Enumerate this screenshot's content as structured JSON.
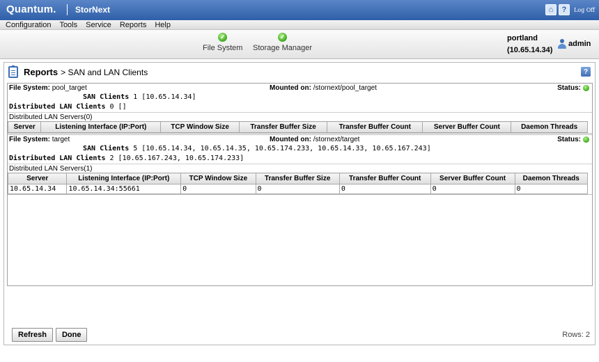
{
  "header": {
    "brand": "Quantum.",
    "product": "StorNext",
    "home_icon": "home-icon",
    "help_icon": "question-icon",
    "logoff_label": "Log Off"
  },
  "menu": {
    "items": [
      "Configuration",
      "Tools",
      "Service",
      "Reports",
      "Help"
    ]
  },
  "status": {
    "items": [
      {
        "label": "File System",
        "icon": "check-icon",
        "color": "#3caa1e"
      },
      {
        "label": "Storage Manager",
        "icon": "check-icon",
        "color": "#3caa1e"
      }
    ],
    "server_name": "portland",
    "server_ip": "(10.65.14.34)",
    "user": "admin"
  },
  "page": {
    "title_bold": "Reports",
    "title_rest": "> SAN and LAN Clients",
    "help": "?"
  },
  "filesystems": [
    {
      "fs_label": "File System:",
      "fs_name": "pool_target",
      "mount_label": "Mounted on:",
      "mount_path": "/stornext/pool_target",
      "status_label": "Status:",
      "san_label": "SAN Clients",
      "san_value": "1 [10.65.14.34]",
      "lan_label": "Distributed LAN Clients",
      "lan_value": "0 []",
      "servers_label": "Distributed LAN Servers",
      "servers_count": "(0)"
    },
    {
      "fs_label": "File System:",
      "fs_name": "target",
      "mount_label": "Mounted on:",
      "mount_path": "/stornext/target",
      "status_label": "Status:",
      "san_label": "SAN Clients",
      "san_value": "5 [10.65.14.34, 10.65.14.35, 10.65.174.233, 10.65.14.33, 10.65.167.243]",
      "lan_label": "Distributed LAN Clients",
      "lan_value": "2 [10.65.167.243, 10.65.174.233]",
      "servers_label": "Distributed LAN Servers",
      "servers_count": "(1)"
    }
  ],
  "table": {
    "columns": [
      "Server",
      "Listening Interface (IP:Port)",
      "TCP Window Size",
      "Transfer Buffer Size",
      "Transfer Buffer Count",
      "Server Buffer Count",
      "Daemon Threads"
    ],
    "rows": [
      [
        "10.65.14.34",
        "10.65.14.34:55661",
        "0",
        "0",
        "0",
        "0",
        "0"
      ]
    ]
  },
  "footer": {
    "refresh_label": "Refresh",
    "done_label": "Done",
    "rows_label": "Rows: 2"
  }
}
